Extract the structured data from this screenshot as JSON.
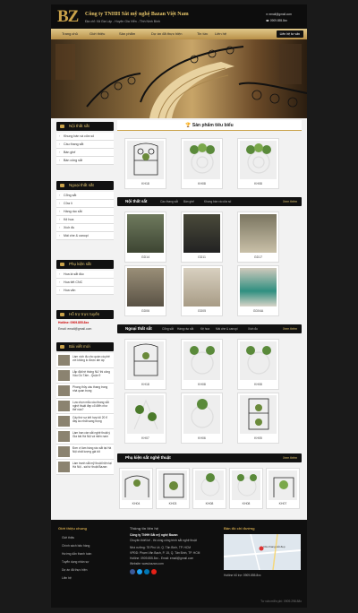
{
  "header": {
    "logo": "BZ",
    "company": "Công ty TNHH Sắt mỹ nghệ Bazan Việt Nam",
    "address": "Địa chỉ: Xã Gia Lập - Huyện Gia Viễn - Tỉnh Ninh Bình",
    "email": "email@gmail.com",
    "phone": "0909.855.8xx"
  },
  "nav": {
    "items": [
      "Trang chủ",
      "Giới thiệu",
      "Sản phẩm",
      "Dự án đã thực hiện",
      "Tin tức",
      "Liên hệ"
    ],
    "button": "Liên hệ tư vấn"
  },
  "sidebar": {
    "sec1": {
      "title": "Nội thất sắt",
      "items": [
        "Khung bàn và cửa số",
        "Cầu thang sắt",
        "Bàn ghế",
        "Bàn công sắt"
      ]
    },
    "sec2": {
      "title": "Ngoại thất sắt",
      "items": [
        "Cổng sắt",
        "Cửa lì",
        "Hàng rào sắt",
        "Kệ hoa",
        "Xích đu",
        "Mái che & canopi"
      ]
    },
    "sec3": {
      "title": "Phụ kiện sắt",
      "items": [
        "Hoa lá sắt đúc",
        "Hoa tiết CNC",
        "Hoa văn"
      ]
    },
    "support": {
      "title": "Hỗ trợ trực tuyến",
      "hotline": "Hotline: 0909.855.8xx",
      "email": "Email: email@gmail.com"
    },
    "news": {
      "title": "Bài viết mới",
      "items": [
        "Làm xích đu cho quán cà phê với không lo được ấm áp",
        "Lắp đặt hệ thống NƯ thi công Vâu Gò Tấm - Quận 9",
        "Phong thủy cầu thang trong nhà quan trọng",
        "Lựa chọn mẫu cầu thang sắt nghệ thuật đẹp cổ điển như thế nào?",
        "Cây thờ sự kết hợp tối 20 tỉ đáy ảo nhất sang trọng",
        "Làm ban cần sắt nghệ thuật ý Gia bài Hà Nội và miền nam",
        "Đơn vị làm hàng rào sắt tại Hà Nội chất lượng giá tốt",
        "Làm tranh sắt mỹ thuật hiện tại Hà Nội - sài tứ thuật Bazan"
      ]
    }
  },
  "main": {
    "featured": {
      "title": "Sản phẩm tiêu biểu",
      "products": [
        "KH18",
        "KH08",
        "KH08"
      ]
    },
    "indoor": {
      "title": "Nội thất sắt",
      "more": "Xem thêm",
      "tabs": [
        "Cầu thang sắt",
        "Bàn ghế",
        "Khung bàn và cửa số"
      ],
      "products": [
        "GD14",
        "GD11",
        "GD17",
        "GD06",
        "GD05",
        "GD04A"
      ]
    },
    "outdoor": {
      "title": "Ngoại thất sắt",
      "more": "Xem thêm",
      "tabs": [
        "Cổng sắt",
        "Hàng rào sắt",
        "Kệ hoa",
        "Mái che & canopi",
        "Xích đu"
      ],
      "products": [
        "KH18",
        "KH08",
        "KH08",
        "KH07",
        "KH06",
        "KH05"
      ]
    },
    "accessories": {
      "title": "Phụ kiện sắt nghệ thuật",
      "more": "Xem thêm",
      "products": [
        "KH04",
        "KH03",
        "KH08",
        "KH08",
        "KH07"
      ]
    }
  },
  "footer": {
    "col1": {
      "title": "Giới thiệu chung",
      "items": [
        "Giới thiệu",
        "Chính sách bảo hàng",
        "Hướng dẫn thanh toán",
        "Tuyển dụng nhân sự",
        "Dự án đã thực hiện",
        "Liên hệ"
      ]
    },
    "col2": {
      "title": "Thông tin liên hệ",
      "company": "Công ty TNHH Sắt mỹ nghệ Bazan",
      "lines": [
        "Chuyên thiết kế - thi công công trình sắt nghệ thuật",
        "Nhà xưởng: 78 Phó Lê, Q. Tân Bình, TP. HCM",
        "VPĐD: Phạm Văn Bạch, P. 15, Q. Tân Bình, TP. HCM",
        "Hotline: 0909.855.8xx - Email: email@gmail.com",
        "Website: www.bazan.com"
      ]
    },
    "col3": {
      "title": "Bản đồ chỉ đường",
      "map_label": "Cầu thang sắt đẹp",
      "hotline": "Hotline hỗ trợ: 0909.855.8xx"
    },
    "copyright": "Tư vấn miễn phí: 0909.298.88x"
  },
  "colors": {
    "gold": "#c9a24a",
    "dark": "#111111",
    "footer": "#0f0f0f"
  }
}
